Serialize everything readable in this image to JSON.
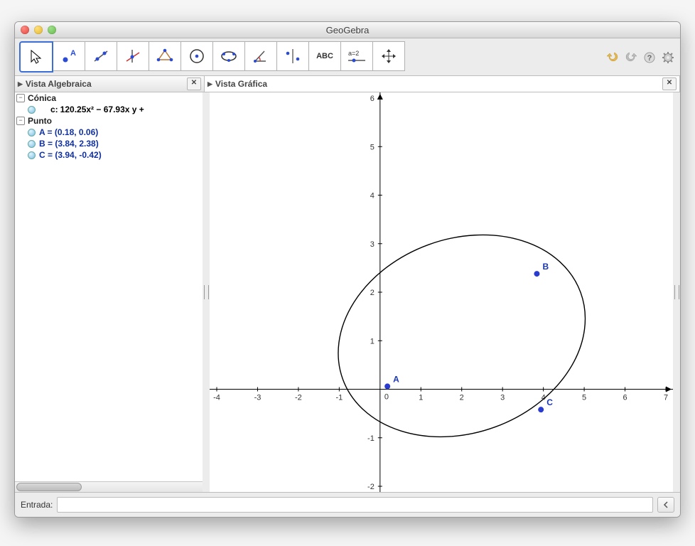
{
  "window": {
    "title": "GeoGebra"
  },
  "toolbar": {
    "tools": [
      {
        "name": "move-tool",
        "selected": true
      },
      {
        "name": "point-tool"
      },
      {
        "name": "line-tool"
      },
      {
        "name": "perpendicular-tool"
      },
      {
        "name": "polygon-tool"
      },
      {
        "name": "circle-tool"
      },
      {
        "name": "conic-tool"
      },
      {
        "name": "angle-tool"
      },
      {
        "name": "reflect-tool"
      },
      {
        "name": "text-tool",
        "label": "ABC"
      },
      {
        "name": "slider-tool",
        "label": "a=2"
      },
      {
        "name": "move-view-tool"
      }
    ]
  },
  "panels": {
    "algebra_title": "Vista Algebraica",
    "graphics_title": "Vista Gráfica"
  },
  "algebra": {
    "categories": [
      {
        "name": "Cónica",
        "items": [
          {
            "prefix": "c:",
            "text": "120.25x² − 67.93x y + "
          }
        ]
      },
      {
        "name": "Punto",
        "items": [
          {
            "text": "A = (0.18, 0.06)"
          },
          {
            "text": "B = (3.84, 2.38)"
          },
          {
            "text": "C = (3.94, -0.42)"
          }
        ]
      }
    ]
  },
  "inputbar": {
    "label": "Entrada:",
    "value": ""
  },
  "chart_data": {
    "type": "scatter",
    "title": "",
    "xlabel": "",
    "ylabel": "",
    "xlim": [
      -4,
      7
    ],
    "ylim": [
      -2,
      6
    ],
    "xticks": [
      -4,
      -3,
      -2,
      -1,
      0,
      1,
      2,
      3,
      4,
      5,
      6,
      7
    ],
    "yticks": [
      -2,
      -1,
      0,
      1,
      2,
      3,
      4,
      5,
      6
    ],
    "series": [
      {
        "name": "A",
        "x": 0.18,
        "y": 0.06
      },
      {
        "name": "B",
        "x": 3.84,
        "y": 2.38
      },
      {
        "name": "C",
        "x": 3.94,
        "y": -0.42
      }
    ],
    "conic": {
      "name": "c",
      "equation_visible": "120.25x² − 67.93x y + ",
      "ellipse": {
        "cx": 2.0,
        "cy": 1.1,
        "rx": 3.1,
        "ry": 2.0,
        "rotate_deg": 20
      }
    }
  }
}
